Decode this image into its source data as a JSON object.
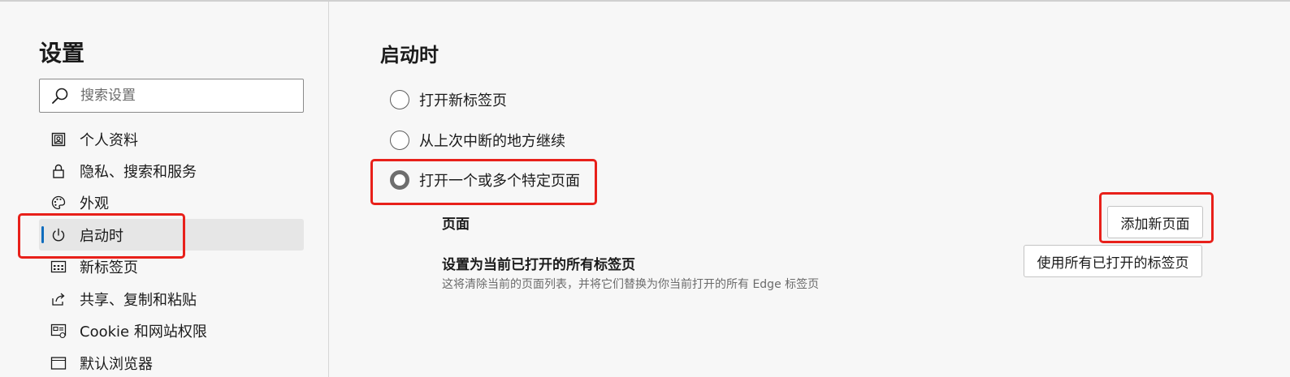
{
  "sidebar": {
    "title": "设置",
    "search": {
      "placeholder": "搜索设置",
      "value": ""
    },
    "items": [
      {
        "label": "个人资料",
        "icon": "profile-icon"
      },
      {
        "label": "隐私、搜索和服务",
        "icon": "lock-icon"
      },
      {
        "label": "外观",
        "icon": "palette-icon"
      },
      {
        "label": "启动时",
        "icon": "power-icon",
        "active": true
      },
      {
        "label": "新标签页",
        "icon": "new-tab-grid-icon"
      },
      {
        "label": "共享、复制和粘贴",
        "icon": "share-icon"
      },
      {
        "label": "Cookie 和网站权限",
        "icon": "site-permissions-icon"
      },
      {
        "label": "默认浏览器",
        "icon": "browser-window-icon"
      }
    ]
  },
  "main": {
    "title": "启动时",
    "options": [
      {
        "label": "打开新标签页",
        "selected": false
      },
      {
        "label": "从上次中断的地方继续",
        "selected": false
      },
      {
        "label": "打开一个或多个特定页面",
        "selected": true
      }
    ],
    "pages": {
      "label": "页面",
      "add_button": "添加新页面"
    },
    "set_all": {
      "title": "设置为当前已打开的所有标签页",
      "description": "这将清除当前的页面列表，并将它们替换为你当前打开的所有 Edge 标签页",
      "button": "使用所有已打开的标签页"
    }
  },
  "colors": {
    "accent": "#0f6cbd",
    "highlight": "#e8201a",
    "background": "#f7f7f7"
  }
}
